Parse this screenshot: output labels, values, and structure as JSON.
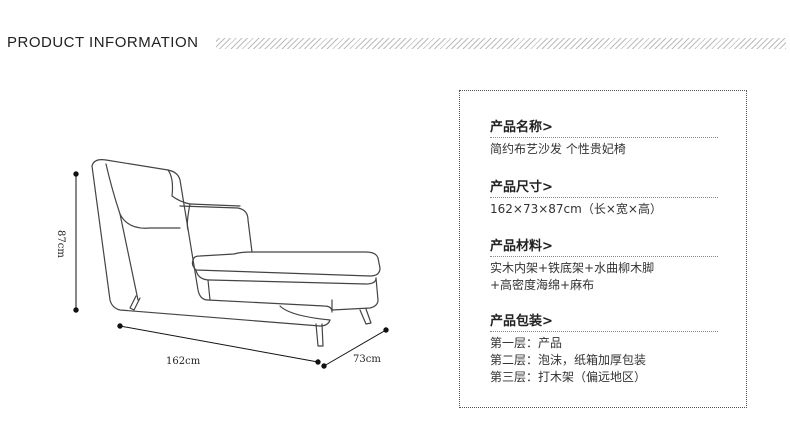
{
  "header": {
    "title": "PRODUCT INFORMATION"
  },
  "drawing": {
    "width_label": "162cm",
    "depth_label": "73cm",
    "height_label": "87cm"
  },
  "info": {
    "sections": [
      {
        "title": "产品名称>",
        "lines": [
          "简约布艺沙发 个性贵妃椅"
        ]
      },
      {
        "title": "产品尺寸>",
        "lines": [
          "162×73×87cm（长×宽×高）"
        ]
      },
      {
        "title": "产品材料>",
        "lines": [
          "实木内架+铁底架+水曲柳木脚",
          "+高密度海绵+麻布"
        ]
      },
      {
        "title": "产品包装>",
        "lines": [
          "第一层：产品",
          "第二层：泡沫，纸箱加厚包装",
          "第三层：打木架（偏远地区）"
        ]
      }
    ]
  }
}
